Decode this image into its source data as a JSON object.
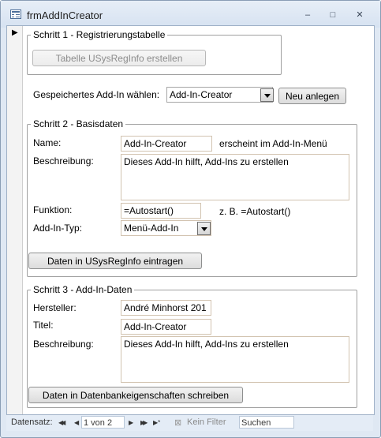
{
  "window": {
    "title": "frmAddInCreator",
    "icon": "form-icon",
    "controls": {
      "minimize": "–",
      "maximize": "□",
      "close": "✕"
    }
  },
  "record_selector": {
    "marker": "▶"
  },
  "section1": {
    "title": "Schritt 1 - Registrierungstabelle",
    "create_button": "Tabelle USysRegInfo erstellen"
  },
  "saved_addin": {
    "label": "Gespeichertes Add-In wählen:",
    "value": "Add-In-Creator",
    "new_button": "Neu anlegen"
  },
  "section2": {
    "title": "Schritt 2 - Basisdaten",
    "name_label": "Name:",
    "name_value": "Add-In-Creator",
    "name_hint": "erscheint im Add-In-Menü",
    "desc_label": "Beschreibung:",
    "desc_value": "Dieses Add-In hilft, Add-Ins zu erstellen",
    "func_label": "Funktion:",
    "func_value": "=Autostart()",
    "func_hint": "z. B. =Autostart()",
    "type_label": "Add-In-Typ:",
    "type_value": "Menü-Add-In",
    "write_button": "Daten in USysRegInfo eintragen"
  },
  "section3": {
    "title": "Schritt 3 - Add-In-Daten",
    "vendor_label": "Hersteller:",
    "vendor_value": "André Minhorst 201",
    "title_label": "Titel:",
    "title_value": "Add-In-Creator",
    "desc_label": "Beschreibung:",
    "desc_value": "Dieses Add-In hilft, Add-Ins zu erstellen",
    "write_button": "Daten in Datenbankeigenschaften schreiben"
  },
  "navigation": {
    "label": "Datensatz:",
    "first": "◀◀",
    "prev": "◀",
    "position": "1 von 2",
    "next": "▶",
    "last": "▶▶",
    "new": "▶*",
    "filter": "Kein Filter",
    "search": "Suchen"
  }
}
